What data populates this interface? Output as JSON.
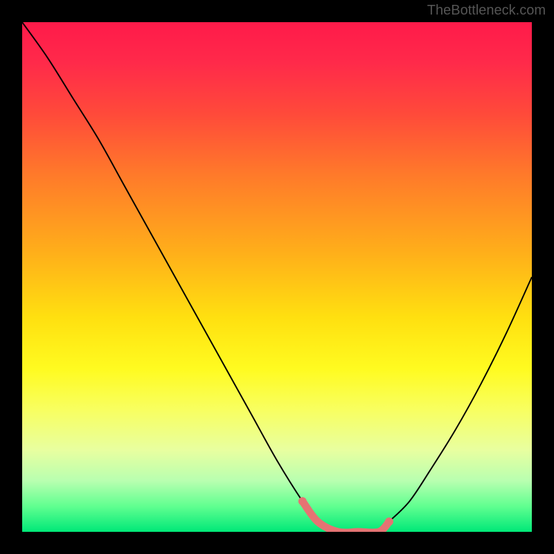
{
  "watermark": "TheBottleneck.com",
  "chart_data": {
    "type": "line",
    "title": "",
    "xlabel": "",
    "ylabel": "",
    "xlim": [
      0,
      100
    ],
    "ylim": [
      0,
      100
    ],
    "series": [
      {
        "name": "bottleneck-curve",
        "x": [
          0,
          5,
          10,
          15,
          20,
          25,
          30,
          35,
          40,
          45,
          50,
          55,
          58,
          62,
          66,
          70,
          72,
          76,
          80,
          85,
          90,
          95,
          100
        ],
        "values": [
          100,
          93,
          85,
          77,
          68,
          59,
          50,
          41,
          32,
          23,
          14,
          6,
          2,
          0,
          0,
          0,
          2,
          6,
          12,
          20,
          29,
          39,
          50
        ]
      }
    ],
    "marker_band": {
      "x_start": 55,
      "x_end": 72,
      "color": "#e57373"
    },
    "colors": {
      "curve": "#000000",
      "marker": "#e57373",
      "background_top": "#ff1a4a",
      "background_bottom": "#00e878"
    }
  }
}
